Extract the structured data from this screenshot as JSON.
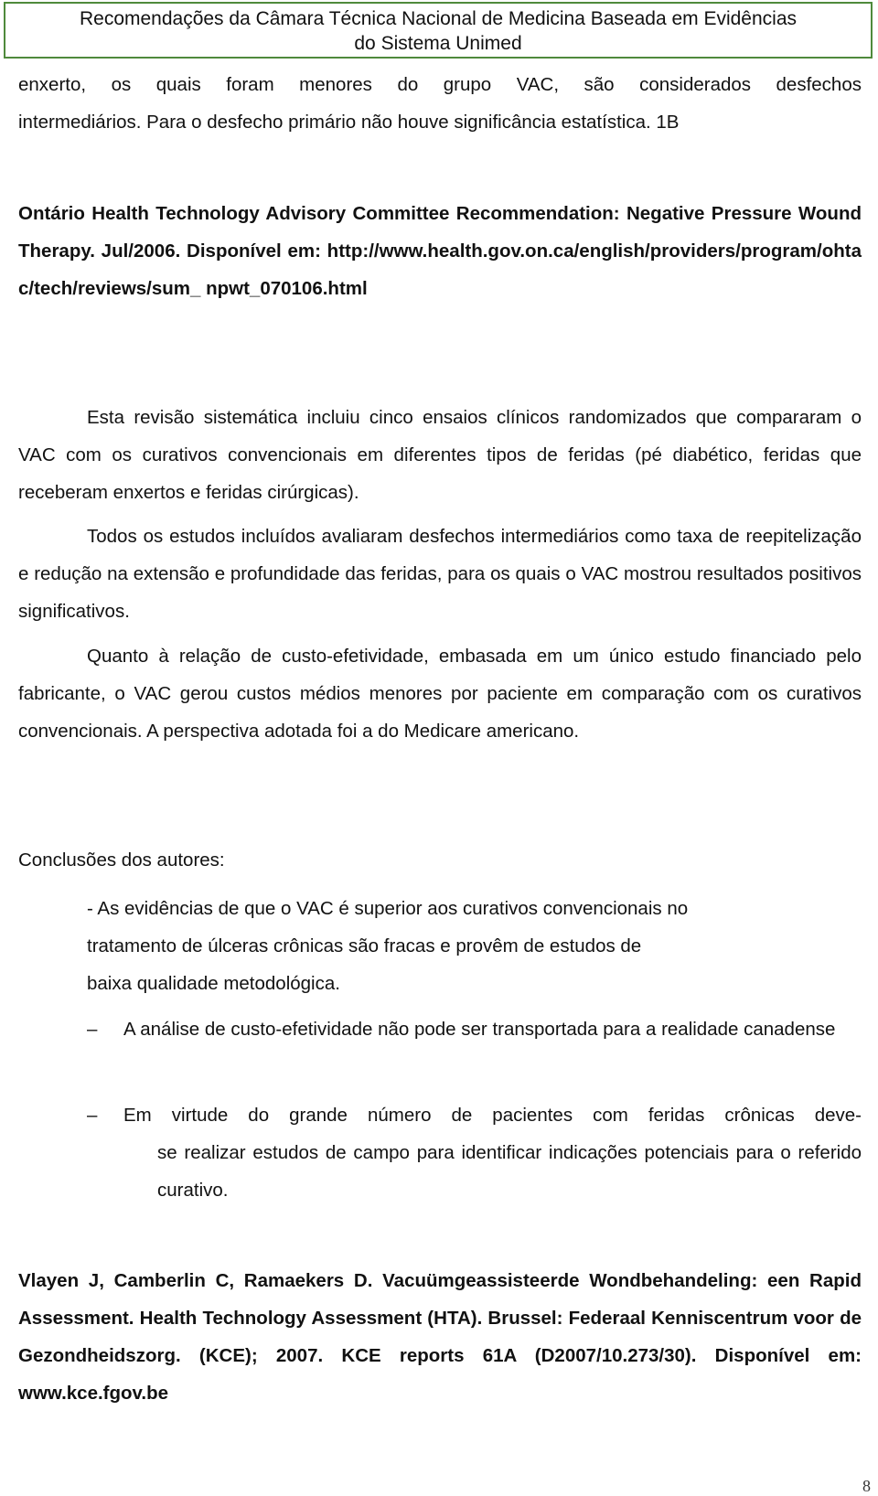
{
  "header": {
    "line1": "Recomendações da Câmara Técnica Nacional de Medicina Baseada em Evidências",
    "line2": "do Sistema Unimed"
  },
  "intro": {
    "line1": "enxerto, os quais foram menores do grupo VAC, são considerados desfechos",
    "line2": "intermediários. Para o desfecho primário não houve significância estatística. 1B"
  },
  "ref1": {
    "text": "Ontário Health Technology Advisory Committee Recommendation: Negative Pressure Wound Therapy. Jul/2006. Disponível em: http://www.health.gov.on.ca/english/providers/program/ohtac/tech/reviews/sum_ npwt_070106.html"
  },
  "paragraphs": [
    "Esta revisão sistemática incluiu cinco ensaios clínicos randomizados que compararam o VAC com os curativos convencionais em diferentes tipos de feridas (pé diabético, feridas que receberam enxertos e feridas cirúrgicas).",
    "Todos os estudos incluídos avaliaram desfechos intermediários como taxa de reepitelização e redução na extensão e profundidade das feridas, para os quais o VAC mostrou resultados positivos significativos.",
    "Quanto à relação de custo-efetividade, embasada em um único estudo financiado pelo fabricante, o VAC gerou custos médios menores por paciente em comparação com os curativos convencionais. A perspectiva adotada foi a do Medicare americano."
  ],
  "conclusions": {
    "heading": "Conclusões dos autores:",
    "item1_lines": [
      "- As evidências de que o VAC é superior aos curativos convencionais no",
      "tratamento de úlceras crônicas são fracas e provêm de estudos de",
      "baixa qualidade metodológica."
    ],
    "bullets": [
      {
        "marker": "–",
        "text": "A análise de custo-efetividade não pode ser transportada para a realidade canadense"
      },
      {
        "marker": "–",
        "first": "Em virtude do grande número de pacientes com feridas crônicas deve-",
        "rest": "se realizar estudos de campo para identificar indicações potenciais para o referido curativo."
      }
    ]
  },
  "ref2": {
    "text": "Vlayen J, Camberlin C, Ramaekers D. Vacuümgeassisteerde Wondbehandeling: een Rapid Assessment. Health Technology Assessment (HTA). Brussel: Federaal Kenniscentrum voor de Gezondheidszorg. (KCE); 2007. KCE reports 61A (D2007/10.273/30). Disponível em: www.kce.fgov.be"
  },
  "page_number": "8"
}
